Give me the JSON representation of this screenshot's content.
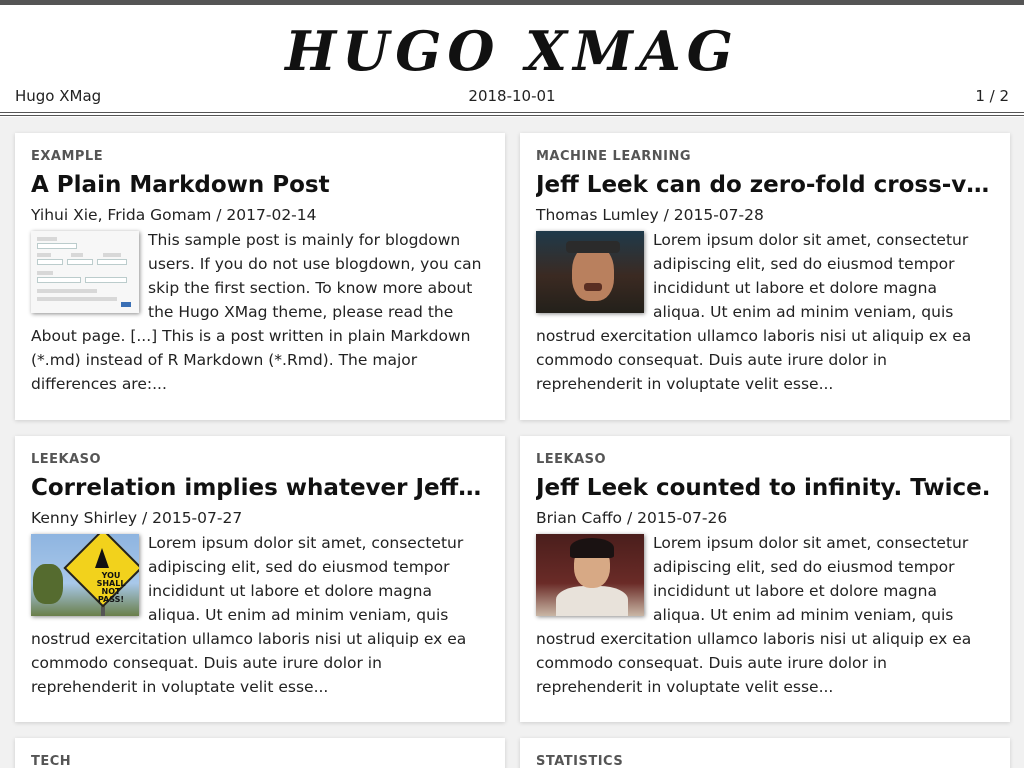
{
  "site": {
    "logo": "HUGO XMAG",
    "name": "Hugo XMag",
    "date": "2018-10-01",
    "page": "1 / 2"
  },
  "posts": [
    {
      "category": "EXAMPLE",
      "title": "A Plain Markdown Post",
      "byline": "Yihui Xie, Frida Gomam / 2017-02-14",
      "excerpt": "This sample post is mainly for blogdown users. If you do not use blogdown, you can skip the first section. To know more about the Hugo XMag theme, please read the About page. [...] This is a post written in plain Markdown (*.md) instead of R Markdown (*.Rmd). The major differences are:...",
      "thumb": "form-screenshot"
    },
    {
      "category": "MACHINE LEARNING",
      "title": "Jeff Leek can do zero-fold cross-va…",
      "byline": "Thomas Lumley / 2015-07-28",
      "excerpt": "Lorem ipsum dolor sit amet, consectetur adipiscing elit, sed do eiusmod tempor incididunt ut labore et dolore magna aliqua. Ut enim ad minim veniam, quis nostrud exercitation ullamco laboris nisi ut aliquip ex ea commodo consequat. Duis aute irure dolor in reprehenderit in voluptate velit esse...",
      "thumb": "portrait-photo"
    },
    {
      "category": "LEEKASO",
      "title": "Correlation implies whatever Jeff L…",
      "byline": "Kenny Shirley / 2015-07-27",
      "excerpt": "Lorem ipsum dolor sit amet, consectetur adipiscing elit, sed do eiusmod tempor incididunt ut labore et dolore magna aliqua. Ut enim ad minim veniam, quis nostrud exercitation ullamco laboris nisi ut aliquip ex ea commodo consequat. Duis aute irure dolor in reprehenderit in voluptate velit esse...",
      "thumb": "road-sign-photo",
      "thumb_text": "YOU SHALL NOT PASS!"
    },
    {
      "category": "LEEKASO",
      "title": "Jeff Leek counted to infinity. Twice.",
      "byline": "Brian Caffo / 2015-07-26",
      "excerpt": "Lorem ipsum dolor sit amet, consectetur adipiscing elit, sed do eiusmod tempor incididunt ut labore et dolore magna aliqua. Ut enim ad minim veniam, quis nostrud exercitation ullamco laboris nisi ut aliquip ex ea commodo consequat. Duis aute irure dolor in reprehenderit in voluptate velit esse...",
      "thumb": "portrait-photo"
    },
    {
      "category": "TECH",
      "title": "",
      "byline": "",
      "excerpt": ""
    },
    {
      "category": "STATISTICS",
      "title": "",
      "byline": "",
      "excerpt": ""
    }
  ]
}
